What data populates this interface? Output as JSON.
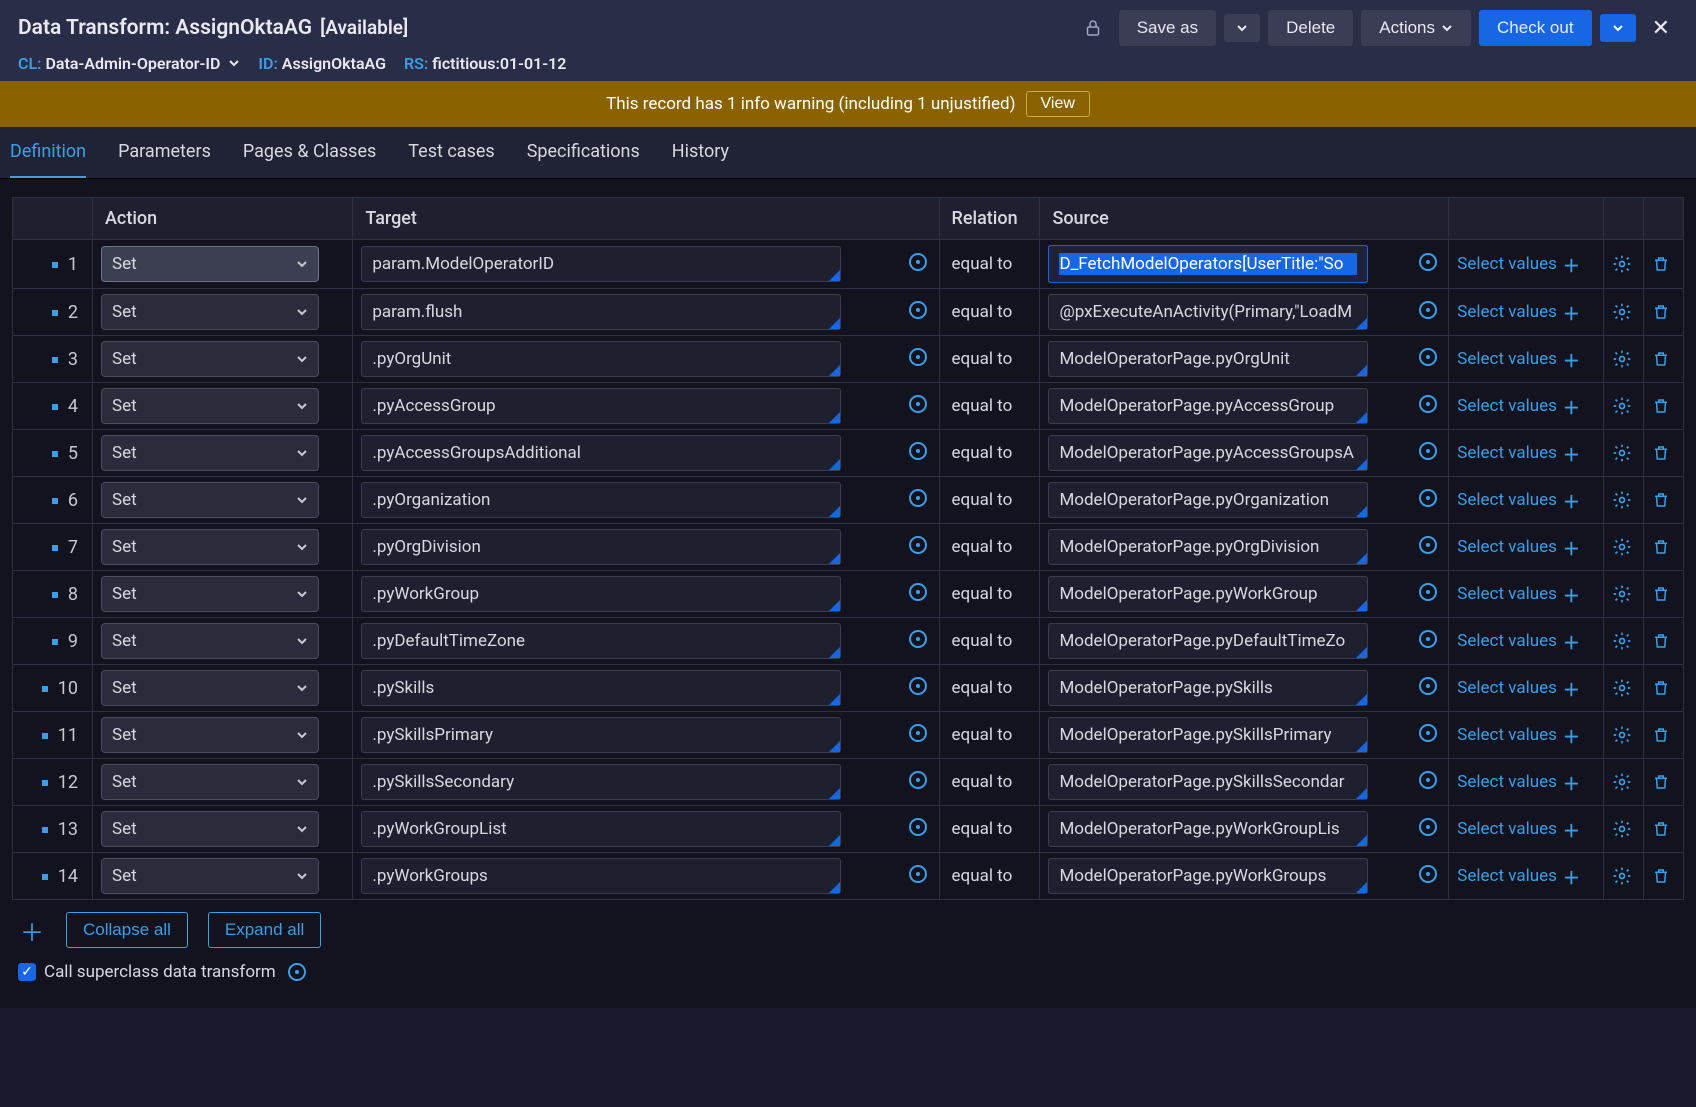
{
  "header": {
    "title": "Data Transform: AssignOktaAG",
    "status": "[Available]",
    "meta": {
      "cl_label": "CL:",
      "cl_value": "Data-Admin-Operator-ID",
      "id_label": "ID:",
      "id_value": "AssignOktaAG",
      "rs_label": "RS:",
      "rs_value": "fictitious:01-01-12"
    },
    "buttons": {
      "save_as": "Save as",
      "delete": "Delete",
      "actions": "Actions",
      "check_out": "Check out"
    }
  },
  "warning": {
    "text": "This record has 1 info warning (including 1 unjustified)",
    "view_label": "View"
  },
  "tabs": [
    "Definition",
    "Parameters",
    "Pages & Classes",
    "Test cases",
    "Specifications",
    "History"
  ],
  "active_tab": 0,
  "columns": {
    "action": "Action",
    "target": "Target",
    "relation": "Relation",
    "source": "Source"
  },
  "action_default": "Set",
  "relation_default": "equal to",
  "select_values_label": "Select values",
  "rows": [
    {
      "num": "1",
      "target": "param.ModelOperatorID",
      "source": "D_FetchModelOperators[UserTitle:\"So",
      "highlighted": true
    },
    {
      "num": "2",
      "target": "param.flush",
      "source": "@pxExecuteAnActivity(Primary,\"LoadM"
    },
    {
      "num": "3",
      "target": ".pyOrgUnit",
      "source": "ModelOperatorPage.pyOrgUnit"
    },
    {
      "num": "4",
      "target": ".pyAccessGroup",
      "source": "ModelOperatorPage.pyAccessGroup"
    },
    {
      "num": "5",
      "target": ".pyAccessGroupsAdditional",
      "source": "ModelOperatorPage.pyAccessGroupsA"
    },
    {
      "num": "6",
      "target": ".pyOrganization",
      "source": "ModelOperatorPage.pyOrganization"
    },
    {
      "num": "7",
      "target": ".pyOrgDivision",
      "source": "ModelOperatorPage.pyOrgDivision"
    },
    {
      "num": "8",
      "target": ".pyWorkGroup",
      "source": "ModelOperatorPage.pyWorkGroup"
    },
    {
      "num": "9",
      "target": ".pyDefaultTimeZone",
      "source": "ModelOperatorPage.pyDefaultTimeZo"
    },
    {
      "num": "10",
      "target": ".pySkills",
      "source": "ModelOperatorPage.pySkills"
    },
    {
      "num": "11",
      "target": ".pySkillsPrimary",
      "source": "ModelOperatorPage.pySkillsPrimary"
    },
    {
      "num": "12",
      "target": ".pySkillsSecondary",
      "source": "ModelOperatorPage.pySkillsSecondar"
    },
    {
      "num": "13",
      "target": ".pyWorkGroupList",
      "source": "ModelOperatorPage.pyWorkGroupLis"
    },
    {
      "num": "14",
      "target": ".pyWorkGroups",
      "source": "ModelOperatorPage.pyWorkGroups"
    }
  ],
  "footer": {
    "collapse": "Collapse all",
    "expand": "Expand all",
    "superclass_label": "Call superclass data transform",
    "superclass_checked": true
  }
}
